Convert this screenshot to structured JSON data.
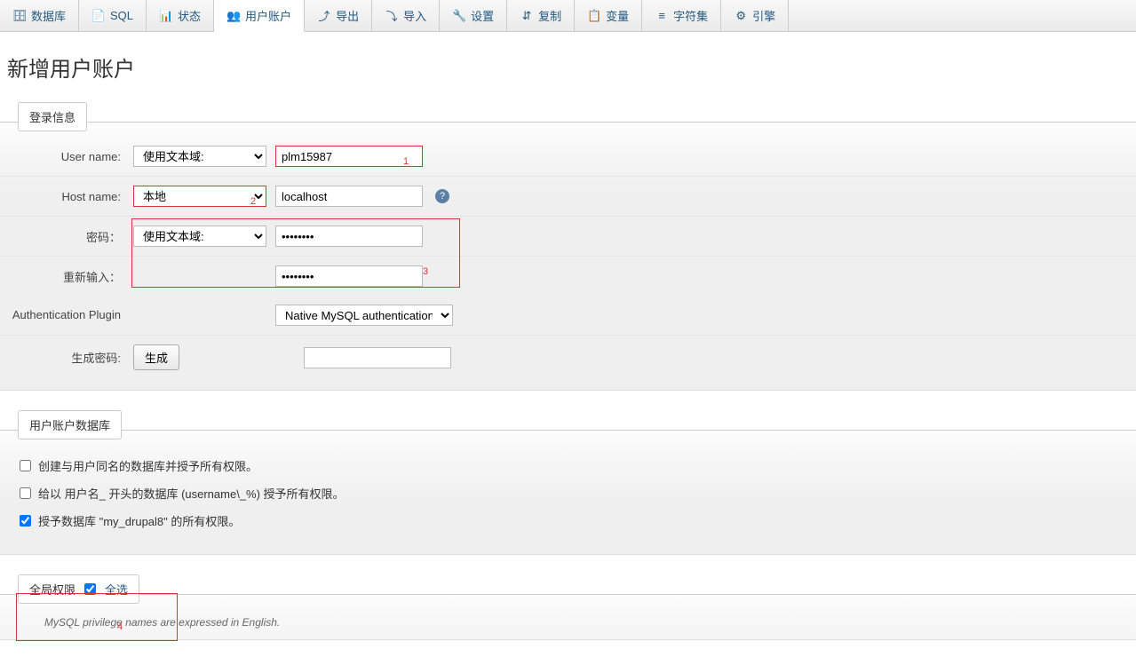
{
  "tabs": [
    {
      "label": "数据库",
      "icon": "🗄"
    },
    {
      "label": "SQL",
      "icon": "📄"
    },
    {
      "label": "状态",
      "icon": "📊"
    },
    {
      "label": "用户账户",
      "icon": "👥",
      "active": true
    },
    {
      "label": "导出",
      "icon": "⤴"
    },
    {
      "label": "导入",
      "icon": "⤵"
    },
    {
      "label": "设置",
      "icon": "🔧"
    },
    {
      "label": "复制",
      "icon": "⇵"
    },
    {
      "label": "变量",
      "icon": "📋"
    },
    {
      "label": "字符集",
      "icon": "≡"
    },
    {
      "label": "引擎",
      "icon": "⚙"
    }
  ],
  "page_title": "新增用户账户",
  "sections": {
    "login": {
      "legend": "登录信息",
      "username_label": "User name:",
      "username_select": "使用文本域:",
      "username_value": "plm15987",
      "hostname_label": "Host name:",
      "hostname_select": "本地",
      "hostname_value": "localhost",
      "password_label": "密码：",
      "password_select": "使用文本域:",
      "password_value": "••••••••",
      "retype_label": "重新输入：",
      "retype_value": "••••••••",
      "auth_label": "Authentication Plugin",
      "auth_select": "Native MySQL authentication",
      "gen_label": "生成密码:",
      "gen_button": "生成"
    },
    "userdb": {
      "legend": "用户账户数据库",
      "opt1": "创建与用户同名的数据库并授予所有权限。",
      "opt2": "给以 用户名_ 开头的数据库 (username\\_%) 授予所有权限。",
      "opt3": "授予数据库 \"my_drupal8\" 的所有权限。"
    },
    "global": {
      "legend": "全局权限",
      "selectall": "全选",
      "footnote": "MySQL privilege names are expressed in English."
    }
  },
  "annotations": {
    "n1": "1",
    "n2": "2",
    "n3": "3",
    "n4": "4"
  }
}
